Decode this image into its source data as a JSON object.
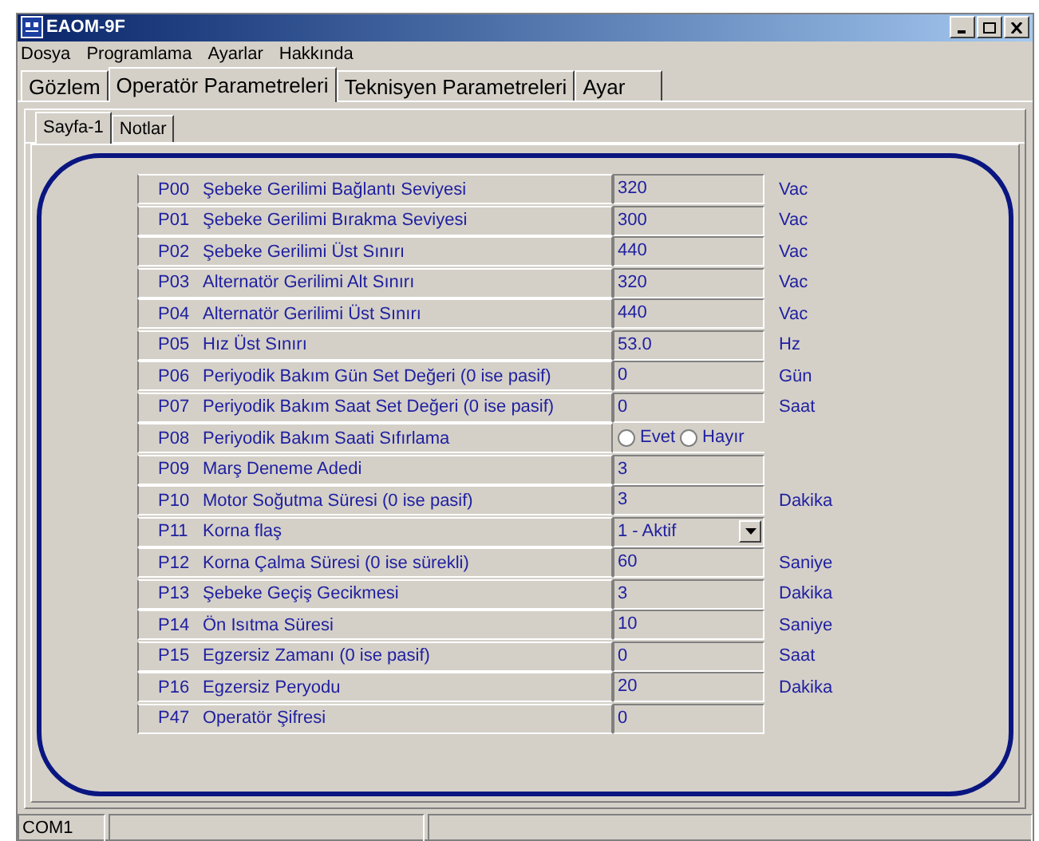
{
  "window": {
    "title": "EAOM-9F"
  },
  "menu": [
    "Dosya",
    "Programlama",
    "Ayarlar",
    "Hakkında"
  ],
  "tabs": [
    {
      "label": "Gözlem",
      "selected": false
    },
    {
      "label": "Operatör Parametreleri",
      "selected": true
    },
    {
      "label": "Teknisyen Parametreleri",
      "selected": false
    },
    {
      "label": "Ayar",
      "selected": false
    }
  ],
  "subtabs": [
    {
      "label": "Sayfa-1",
      "selected": true
    },
    {
      "label": "Notlar",
      "selected": false
    }
  ],
  "parameters": [
    {
      "kind": "text",
      "code": "P00",
      "name": "Şebeke Gerilimi Bağlantı Seviyesi",
      "value": "320",
      "unit": "Vac"
    },
    {
      "kind": "text",
      "code": "P01",
      "name": "Şebeke Gerilimi Bırakma Seviyesi",
      "value": "300",
      "unit": "Vac"
    },
    {
      "kind": "text",
      "code": "P02",
      "name": "Şebeke Gerilimi Üst Sınırı",
      "value": "440",
      "unit": "Vac"
    },
    {
      "kind": "text",
      "code": "P03",
      "name": "Alternatör Gerilimi Alt Sınırı",
      "value": "320",
      "unit": "Vac"
    },
    {
      "kind": "text",
      "code": "P04",
      "name": "Alternatör Gerilimi Üst Sınırı",
      "value": "440",
      "unit": "Vac"
    },
    {
      "kind": "text",
      "code": "P05",
      "name": "Hız Üst Sınırı",
      "value": "53.0",
      "unit": "Hz"
    },
    {
      "kind": "text",
      "code": "P06",
      "name": "Periyodik Bakım Gün Set Değeri (0 ise pasif)",
      "value": "0",
      "unit": "Gün"
    },
    {
      "kind": "text",
      "code": "P07",
      "name": "Periyodik Bakım Saat Set Değeri (0 ise pasif)",
      "value": "0",
      "unit": "Saat"
    },
    {
      "kind": "radio",
      "code": "P08",
      "name": "Periyodik Bakım Saati Sıfırlama",
      "options": [
        {
          "label": "Evet",
          "selected": false
        },
        {
          "label": "Hayır",
          "selected": false
        }
      ]
    },
    {
      "kind": "text",
      "code": "P09",
      "name": "Marş Deneme Adedi",
      "value": "3"
    },
    {
      "kind": "text",
      "code": "P10",
      "name": "Motor Soğutma Süresi (0 ise pasif)",
      "value": "3",
      "unit": "Dakika"
    },
    {
      "kind": "select",
      "code": "P11",
      "name": "Korna flaş",
      "value": "1 - Aktif"
    },
    {
      "kind": "text",
      "code": "P12",
      "name": "Korna Çalma Süresi (0 ise sürekli)",
      "value": "60",
      "unit": "Saniye"
    },
    {
      "kind": "text",
      "code": "P13",
      "name": "Şebeke Geçiş Gecikmesi",
      "value": "3",
      "unit": "Dakika"
    },
    {
      "kind": "text",
      "code": "P14",
      "name": "Ön Isıtma Süresi",
      "value": "10",
      "unit": "Saniye"
    },
    {
      "kind": "text",
      "code": "P15",
      "name": "Egzersiz Zamanı (0 ise pasif)",
      "value": "0",
      "unit": "Saat"
    },
    {
      "kind": "text",
      "code": "P16",
      "name": "Egzersiz Peryodu",
      "value": "20",
      "unit": "Dakika"
    },
    {
      "kind": "text",
      "code": "P47",
      "name": "Operatör Şifresi",
      "value": "0"
    }
  ],
  "status_bar": [
    "COM1"
  ]
}
